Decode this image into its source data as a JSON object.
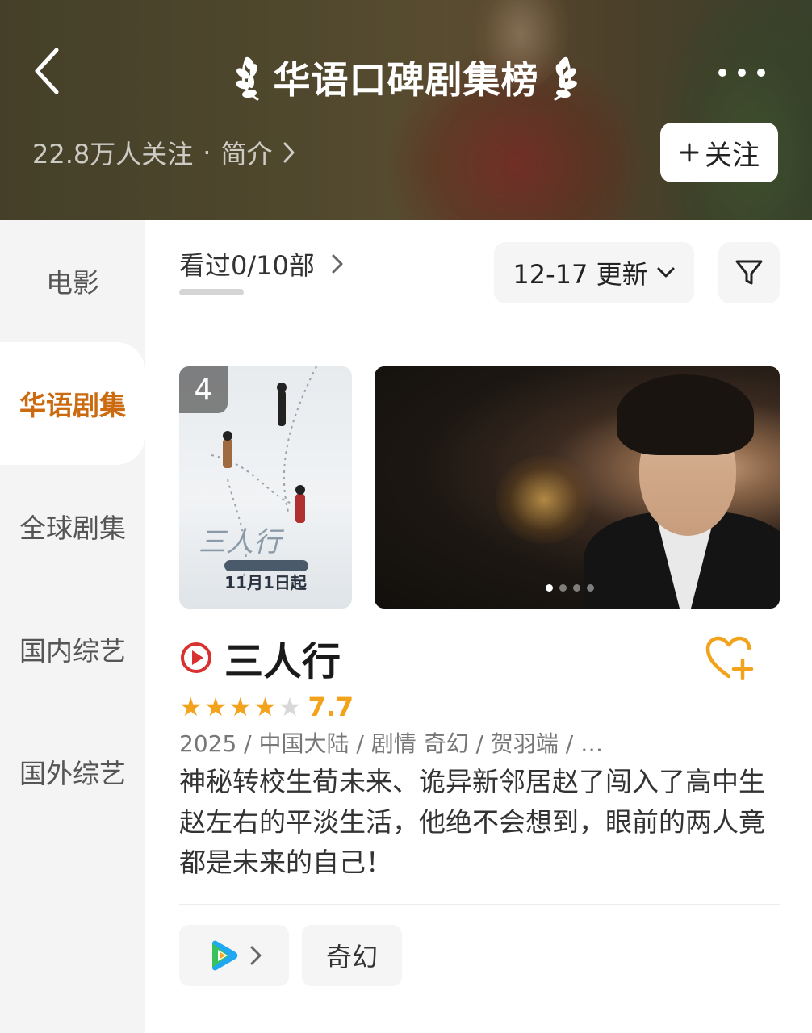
{
  "header": {
    "title": "华语口碑剧集榜",
    "followers": "22.8万人关注",
    "separator": "·",
    "intro_label": "简介",
    "follow_label": "关注"
  },
  "sidebar": {
    "items": [
      {
        "label": "电影",
        "active": false
      },
      {
        "label": "华语剧集",
        "active": true
      },
      {
        "label": "全球剧集",
        "active": false
      },
      {
        "label": "国内综艺",
        "active": false
      },
      {
        "label": "国外综艺",
        "active": false
      }
    ]
  },
  "toolbar": {
    "watched_label": "看过0/10部",
    "watched_progress": 0,
    "date_label": "12-17 更新"
  },
  "show": {
    "rank": "4",
    "poster_date": "11月1日起",
    "title": "三人行",
    "rating": "7.7",
    "stars_filled": 4,
    "stars_total": 5,
    "meta": "2025 / 中国大陆 / 剧情 奇幻 / 贺羽端 / …",
    "description": "神秘转校生荀未来、诡异新邻居赵了闯入了高中生赵左右的平淡生活，他绝不会想到，眼前的两人竟都是未来的自己！",
    "carousel_index": 1,
    "carousel_count": 4,
    "tag": "奇幻"
  },
  "colors": {
    "accent": "#cc6a10",
    "star": "#f2a31b",
    "play_icon": "#d93030",
    "heart": "#f2a31b"
  },
  "icons": {
    "back": "chevron-left-icon",
    "more": "more-dots-icon",
    "filter": "filter-funnel-icon",
    "play": "play-circle-icon",
    "like": "heart-plus-icon",
    "platform": "tencent-video-icon"
  }
}
